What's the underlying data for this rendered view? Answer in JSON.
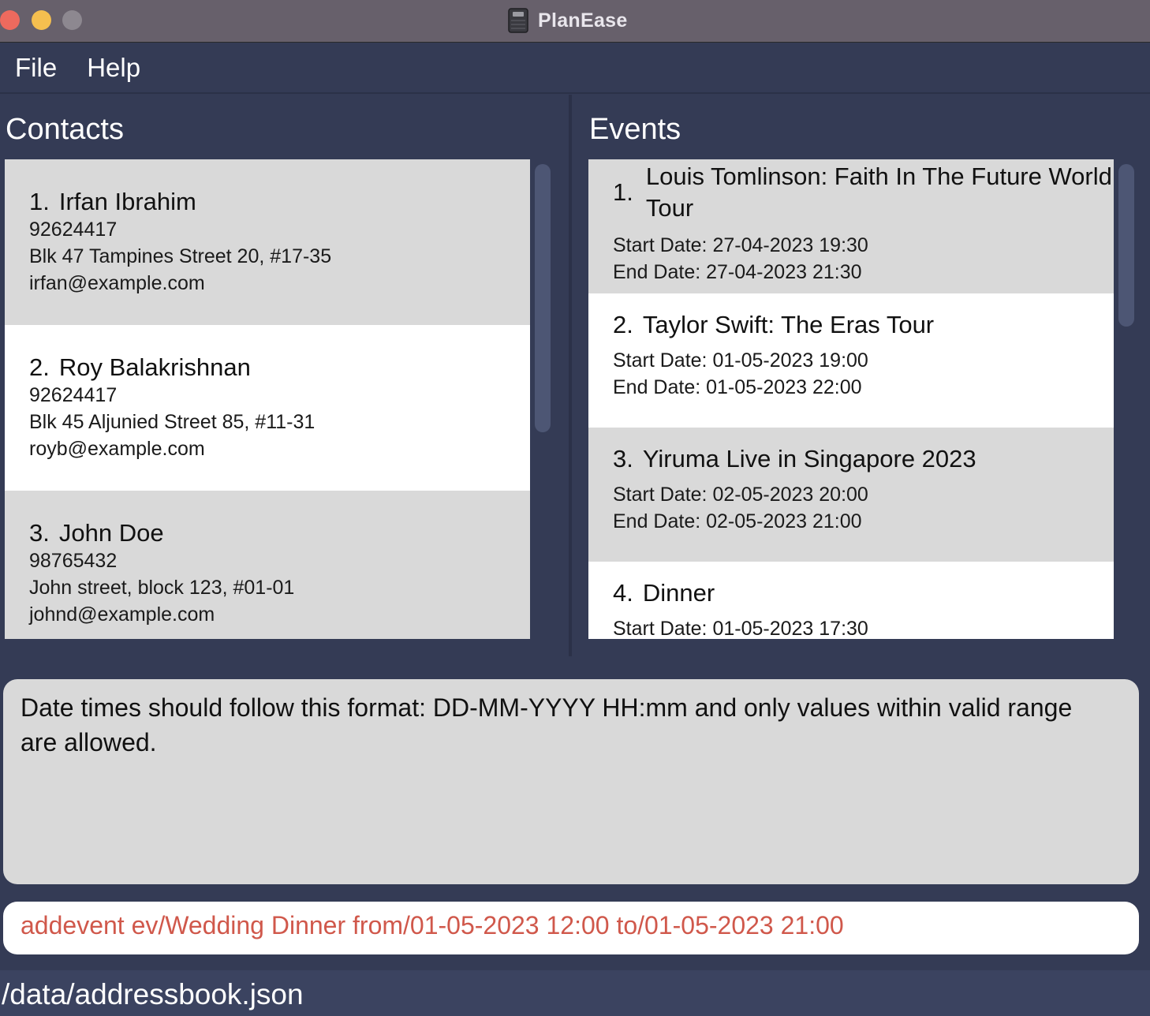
{
  "window": {
    "title": "PlanEase"
  },
  "menu": {
    "file": "File",
    "help": "Help"
  },
  "contacts": {
    "title": "Contacts",
    "items": [
      {
        "index": "1.",
        "name": "Irfan Ibrahim",
        "phone": "92624417",
        "address": "Blk 47 Tampines Street 20, #17-35",
        "email": "irfan@example.com"
      },
      {
        "index": "2.",
        "name": "Roy Balakrishnan",
        "phone": "92624417",
        "address": "Blk 45 Aljunied Street 85, #11-31",
        "email": "royb@example.com"
      },
      {
        "index": "3.",
        "name": "John Doe",
        "phone": "98765432",
        "address": "John street, block 123, #01-01",
        "email": "johnd@example.com"
      }
    ]
  },
  "events": {
    "title": "Events",
    "items": [
      {
        "index": "1.",
        "name_line1": "Louis Tomlinson: Faith In The Future World",
        "name_line2": "Tour",
        "start": "Start Date: 27-04-2023 19:30",
        "end": "End Date: 27-04-2023 21:30"
      },
      {
        "index": "2.",
        "name": "Taylor Swift: The Eras Tour",
        "start": "Start Date: 01-05-2023 19:00",
        "end": "End Date: 01-05-2023 22:00"
      },
      {
        "index": "3.",
        "name": "Yiruma Live in Singapore 2023",
        "start": "Start Date: 02-05-2023 20:00",
        "end": "End Date: 02-05-2023 21:00"
      },
      {
        "index": "4.",
        "name": "Dinner",
        "start": "Start Date: 01-05-2023 17:30"
      }
    ]
  },
  "result": {
    "line1": "Date times should follow this format: DD-MM-YYYY HH:mm and only values within valid range",
    "line2": "are allowed."
  },
  "command": {
    "value": "addevent ev/Wedding Dinner from/01-05-2023  12:00 to/01-05-2023 21:00"
  },
  "status": {
    "path": "/data/addressbook.json"
  },
  "colors": {
    "background": "#343b55",
    "card_grey": "#d9d9d9",
    "card_white": "#ffffff",
    "command_error_text": "#d0584b"
  }
}
